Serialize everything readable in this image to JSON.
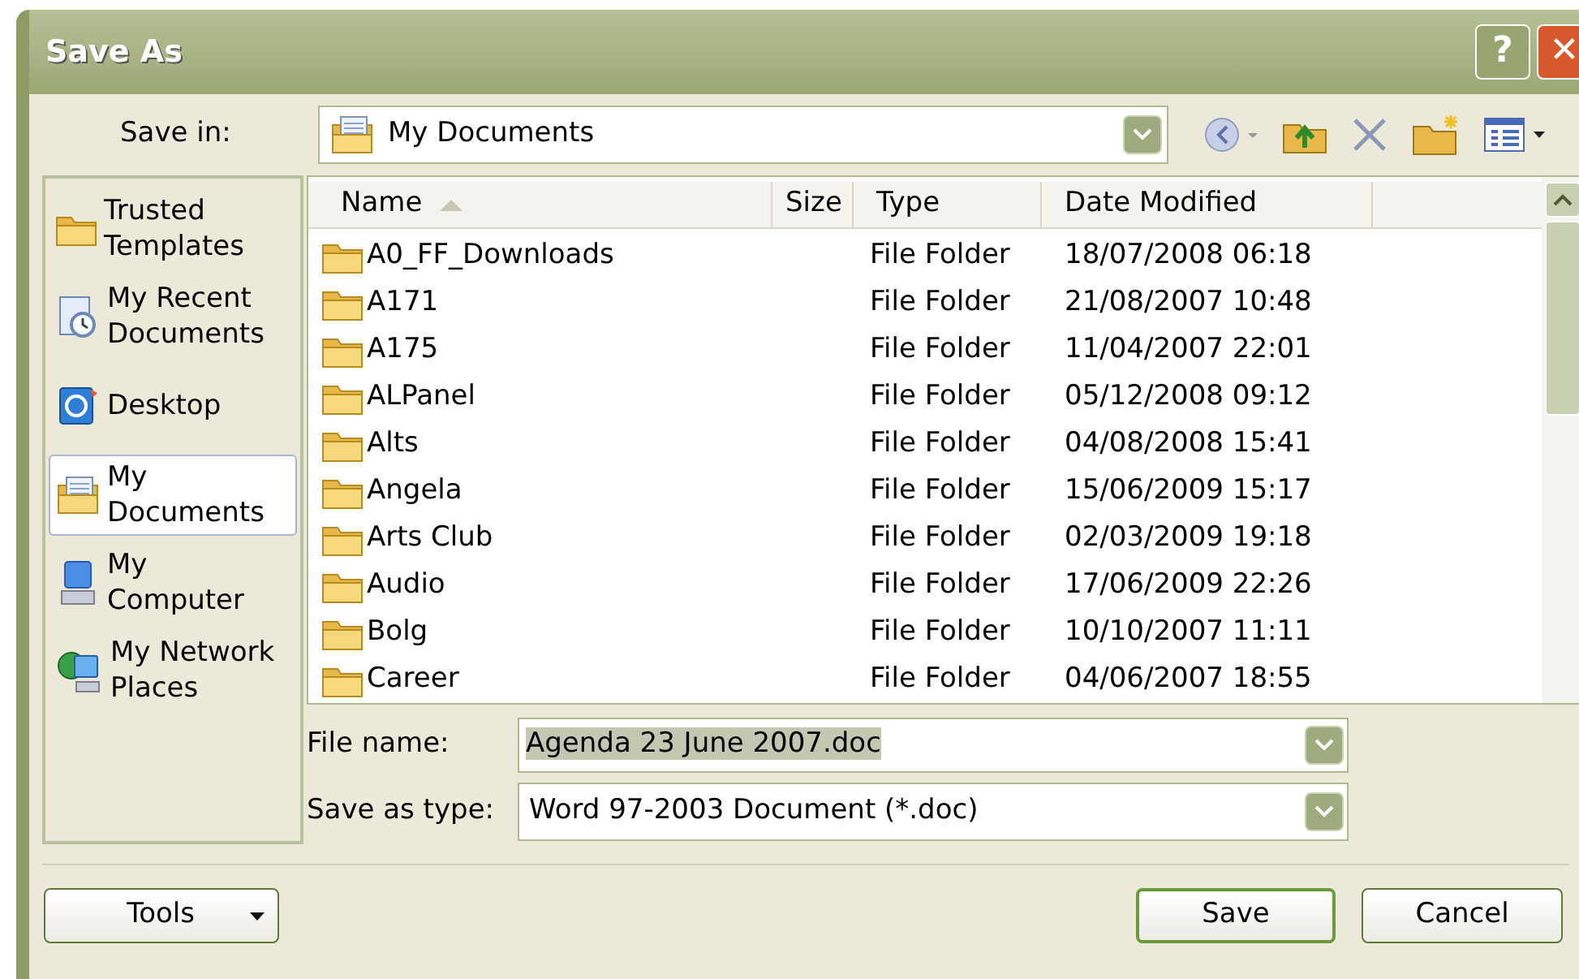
{
  "window": {
    "title": "Save As",
    "buttons": [
      "?",
      "✕"
    ]
  },
  "save_in": {
    "label": "Save in:",
    "value": "My Documents"
  },
  "places": [
    {
      "label": "Trusted Templates",
      "kind": "folder",
      "selected": false
    },
    {
      "label": "My Recent Documents",
      "kind": "recent",
      "selected": false
    },
    {
      "label": "Desktop",
      "kind": "desktop",
      "selected": false
    },
    {
      "label": "My Documents",
      "kind": "documents",
      "selected": true
    },
    {
      "label": "My Computer",
      "kind": "computer",
      "selected": false
    },
    {
      "label": "My Network Places",
      "kind": "network",
      "selected": false
    }
  ],
  "table": {
    "columns": [
      "Name",
      "Size",
      "Type",
      "Date Modified"
    ],
    "rows": [
      {
        "name": "A0_FF_Downloads",
        "type": "File Folder",
        "date": "18/07/2008 06:18"
      },
      {
        "name": "A171",
        "type": "File Folder",
        "date": "21/08/2007 10:48"
      },
      {
        "name": "A175",
        "type": "File Folder",
        "date": "11/04/2007 22:01"
      },
      {
        "name": "ALPanel",
        "type": "File Folder",
        "date": "05/12/2008 09:12"
      },
      {
        "name": "Alts",
        "type": "File Folder",
        "date": "04/08/2008 15:41"
      },
      {
        "name": "Angela",
        "type": "File Folder",
        "date": "15/06/2009 15:17"
      },
      {
        "name": "Arts Club",
        "type": "File Folder",
        "date": "02/03/2009 19:18"
      },
      {
        "name": "Audio",
        "type": "File Folder",
        "date": "17/06/2009 22:26"
      },
      {
        "name": "Bolg",
        "type": "File Folder",
        "date": "10/10/2007 11:11"
      },
      {
        "name": "Career",
        "type": "File Folder",
        "date": "04/06/2007 18:55"
      }
    ]
  },
  "file_name": {
    "label": "File name:",
    "value": "Agenda 23 June 2007.doc"
  },
  "save_as_type": {
    "label": "Save as type:",
    "value": "Word 97-2003 Document (*.doc)"
  },
  "buttons": {
    "tools": "Tools",
    "save": "Save",
    "cancel": "Cancel"
  }
}
